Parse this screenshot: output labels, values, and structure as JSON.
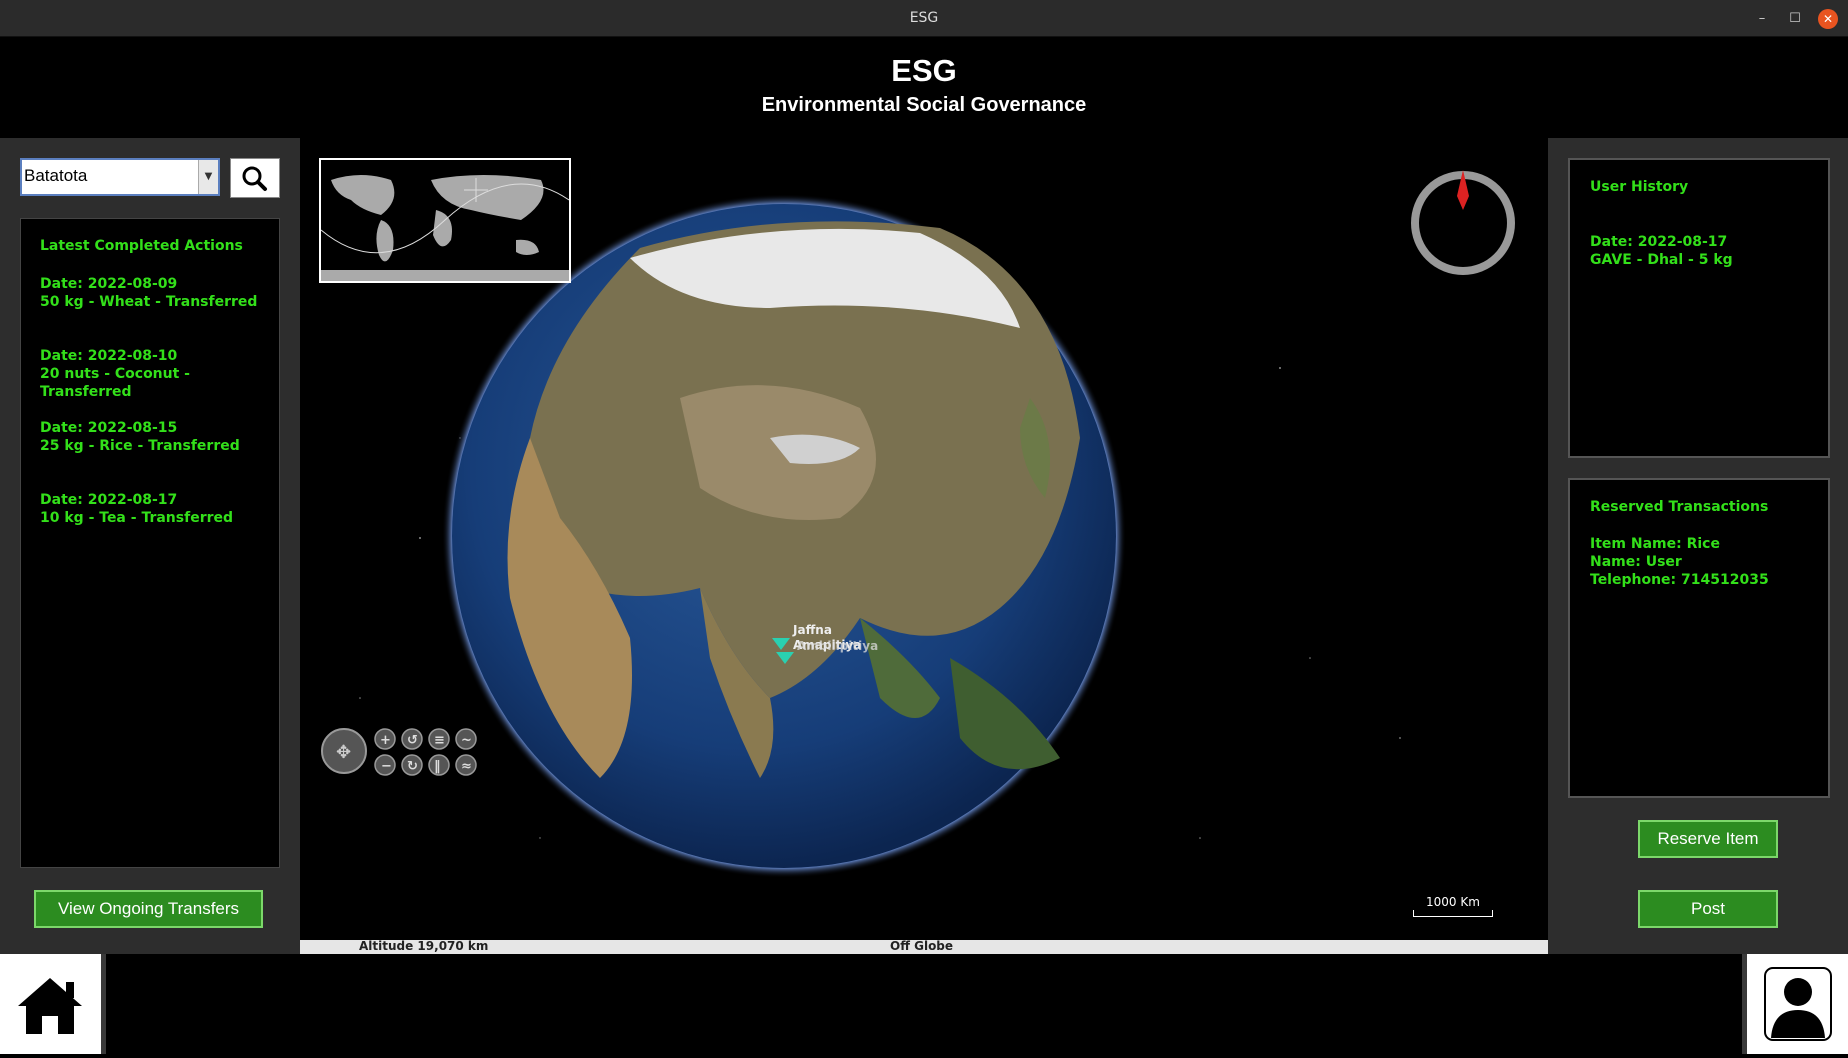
{
  "window": {
    "title": "ESG",
    "minimize": "–",
    "maximize": "☐",
    "close": "✕"
  },
  "header": {
    "title": "ESG",
    "subtitle": "Environmental Social Governance"
  },
  "search": {
    "selected": "Batatota"
  },
  "actions": {
    "heading": "Latest Completed Actions",
    "items": [
      {
        "date": "Date: 2022-08-09",
        "detail": "50 kg - Wheat - Transferred"
      },
      {
        "date": "Date: 2022-08-10",
        "detail": "20 nuts - Coconut - Transferred"
      },
      {
        "date": "Date: 2022-08-15",
        "detail": "25 kg - Rice - Transferred"
      },
      {
        "date": "Date: 2022-08-17",
        "detail": "10 kg - Tea - Transferred"
      }
    ],
    "ongoing_button": "View Ongoing Transfers"
  },
  "map": {
    "markers": [
      "Jaffna",
      "Amapitiya",
      "Ambilipitiya"
    ],
    "scale_label": "1000 Km",
    "status_altitude": "Altitude  19,070 km",
    "status_position": "Off Globe"
  },
  "history": {
    "heading": "User History",
    "date": "Date: 2022-08-17",
    "detail": "GAVE - Dhal - 5 kg"
  },
  "reserved": {
    "heading": "Reserved Transactions",
    "item": "Item Name: Rice",
    "name": "Name: User",
    "phone": "Telephone: 714512035"
  },
  "buttons": {
    "reserve": "Reserve Item",
    "post": "Post"
  },
  "colors": {
    "accent_green": "#33e01a",
    "button_green": "#2c8c20",
    "panel_gray": "#2d2d2d"
  }
}
